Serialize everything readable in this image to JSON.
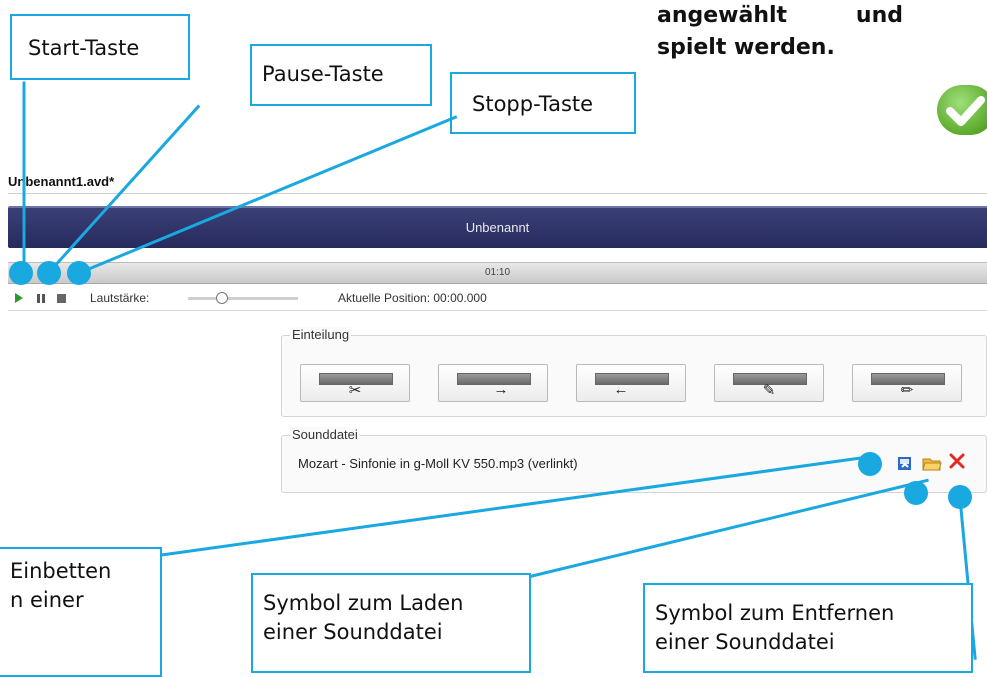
{
  "top_note": {
    "line1": "angewählt und",
    "line2": "spielt werden."
  },
  "callouts": {
    "start": "Start-Taste",
    "pause": "Pause-Taste",
    "stopp": "Stopp-Taste",
    "embed_line1": "Einbetten",
    "embed_line2": "n einer",
    "load_line1": "Symbol zum Laden",
    "load_line2": "einer Sounddatei",
    "remove_line1": "Symbol zum Entfernen",
    "remove_line2": "einer Sounddatei"
  },
  "app": {
    "file_title": "Unbenannt1.avd*",
    "header_title": "Unbenannt",
    "timeline_time": "01:10",
    "volume_label": "Lautstärke:",
    "position_label": "Aktuelle Position: 00:00.000",
    "volume_level": 0.3
  },
  "einteilung": {
    "label": "Einteilung",
    "buttons": [
      "scissors-icon",
      "arrow-right-icon",
      "arrow-left-icon",
      "pen-icon",
      "pencil-icon"
    ]
  },
  "sounddatei": {
    "label": "Sounddatei",
    "filename": "Mozart - Sinfonie in g-Moll KV 550.mp3 (verlinkt)"
  },
  "colors": {
    "accent": "#19a8e0",
    "title_bar": "#2d3166",
    "success": "#5aa82a",
    "remove": "#e02b20"
  }
}
